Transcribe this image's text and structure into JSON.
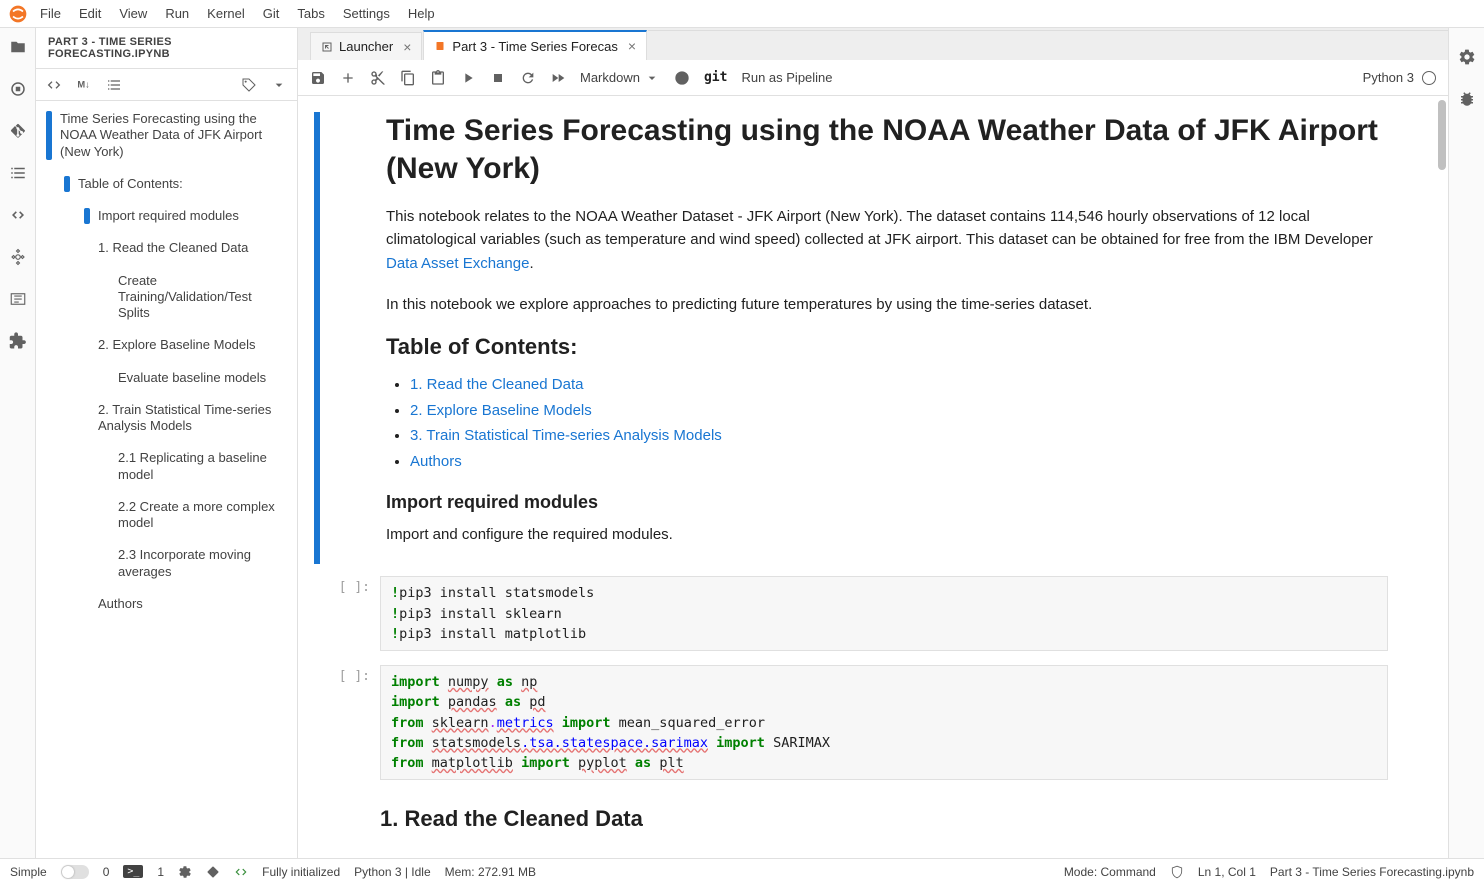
{
  "menubar": {
    "items": [
      "File",
      "Edit",
      "View",
      "Run",
      "Kernel",
      "Git",
      "Tabs",
      "Settings",
      "Help"
    ]
  },
  "sidebar": {
    "title": "PART 3 - TIME SERIES FORECASTING.IPYNB",
    "toc": [
      {
        "level": 0,
        "text": "Time Series Forecasting using the NOAA Weather Data of JFK Airport (New York)",
        "bar": true
      },
      {
        "level": 1,
        "text": "Table of Contents:",
        "bar": true
      },
      {
        "level": 2,
        "text": "Import required modules",
        "bar": true
      },
      {
        "level": 2,
        "text": "1. Read the Cleaned Data",
        "bar": false
      },
      {
        "level": 3,
        "text": "Create Training/Validation/Test Splits",
        "bar": false
      },
      {
        "level": 2,
        "text": "2. Explore Baseline Models",
        "bar": false
      },
      {
        "level": 3,
        "text": "Evaluate baseline models",
        "bar": false
      },
      {
        "level": 2,
        "text": "2. Train Statistical Time-series Analysis Models",
        "bar": false
      },
      {
        "level": 3,
        "text": "2.1 Replicating a baseline model",
        "bar": false
      },
      {
        "level": 3,
        "text": "2.2 Create a more complex model",
        "bar": false
      },
      {
        "level": 3,
        "text": "2.3 Incorporate moving averages",
        "bar": false
      },
      {
        "level": 2,
        "text": "Authors",
        "bar": false
      }
    ]
  },
  "tabs": [
    {
      "label": "Launcher",
      "active": false
    },
    {
      "label": "Part 3 - Time Series Forecas",
      "active": true
    }
  ],
  "toolbar": {
    "cell_type": "Markdown",
    "git_label": "git",
    "pipeline_label": "Run as Pipeline",
    "kernel": "Python 3"
  },
  "notebook": {
    "title": "Time Series Forecasting using the NOAA Weather Data of JFK Airport (New York)",
    "para1_a": "This notebook relates to the NOAA Weather Dataset - JFK Airport (New York). The dataset contains 114,546 hourly observations of 12 local climatological variables (such as temperature and wind speed) collected at JFK airport. This dataset can be obtained for free from the IBM Developer ",
    "para1_link": "Data Asset Exchange",
    "para1_b": ".",
    "para2": "In this notebook we explore approaches to predicting future temperatures by using the time-series dataset.",
    "toc_heading": "Table of Contents:",
    "toc_links": [
      "1. Read the Cleaned Data",
      "2. Explore Baseline Models",
      "3. Train Statistical Time-series Analysis Models",
      "Authors"
    ],
    "import_heading": "Import required modules",
    "import_para": "Import and configure the required modules.",
    "h1_section": "1. Read the Cleaned Data"
  },
  "code_cells": {
    "cell1_lines": [
      "!pip3 install statsmodels",
      "!pip3 install sklearn",
      "!pip3 install matplotlib"
    ],
    "cell2": {
      "l1": {
        "import": "import",
        "mod": "numpy",
        "as": "as",
        "alias": "np"
      },
      "l2": {
        "import": "import",
        "mod": "pandas",
        "as": "as",
        "alias": "pd"
      },
      "l3": {
        "from": "from",
        "mod": "sklearn",
        "dot": ".",
        "sub": "metrics",
        "import": "import",
        "name": "mean_squared_error"
      },
      "l4": {
        "from": "from",
        "mod": "statsmodels",
        "path": ".tsa.statespace.sarimax",
        "import": "import",
        "name": "SARIMAX"
      },
      "l5": {
        "from": "from",
        "mod": "matplotlib",
        "import": "import",
        "name": "pyplot",
        "as": "as",
        "alias": "plt"
      }
    }
  },
  "statusbar": {
    "simple": "Simple",
    "tabs_count": "0",
    "term_count": "1",
    "git_status": "Fully initialized",
    "kernel_status": "Python 3 | Idle",
    "memory": "Mem: 272.91 MB",
    "mode": "Mode: Command",
    "position": "Ln 1, Col 1",
    "filename": "Part 3 - Time Series Forecasting.ipynb"
  }
}
